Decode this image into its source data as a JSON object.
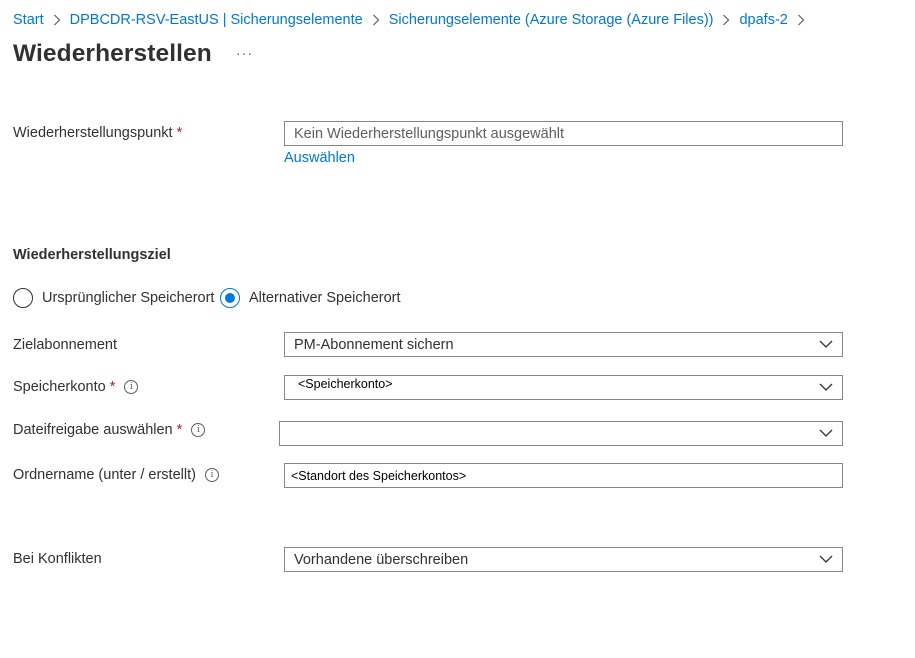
{
  "breadcrumb": {
    "items": [
      "Start",
      "DPBCDR-RSV-EastUS | Sicherungselemente",
      "Sicherungselemente (Azure Storage (Azure Files))",
      "dpafs-2"
    ]
  },
  "page": {
    "title": "Wiederherstellen",
    "more_label": "···"
  },
  "restore_point": {
    "label": "Wiederherstellungspunkt",
    "required_mark": "*",
    "placeholder": "Kein Wiederherstellungspunkt ausgewählt",
    "select_link": "Auswählen"
  },
  "restore_target": {
    "heading": "Wiederherstellungsziel",
    "options": [
      "Ursprünglicher Speicherort",
      "Alternativer Speicherort"
    ],
    "selected_index": 1
  },
  "fields": {
    "subscription": {
      "label": "Zielabonnement",
      "value": "PM-Abonnement sichern"
    },
    "storage_account": {
      "label": "Speicherkonto",
      "required_mark": "*",
      "value": "<Speicherkonto>"
    },
    "file_share": {
      "label": "Dateifreigabe auswählen",
      "required_mark": "*",
      "value": ""
    },
    "folder_name": {
      "label": "Ordnername (unter / erstellt)",
      "value": "<Standort des Speicherkontos>"
    },
    "conflicts": {
      "label": "Bei Konflikten",
      "value": "Vorhandene überschreiben"
    }
  },
  "icons": {
    "info": "info-icon",
    "chevron": "chevron-down-icon",
    "separator": "chevron-right-icon"
  },
  "colors": {
    "link": "#0078d4",
    "required": "#a4262c",
    "text": "#323130"
  }
}
